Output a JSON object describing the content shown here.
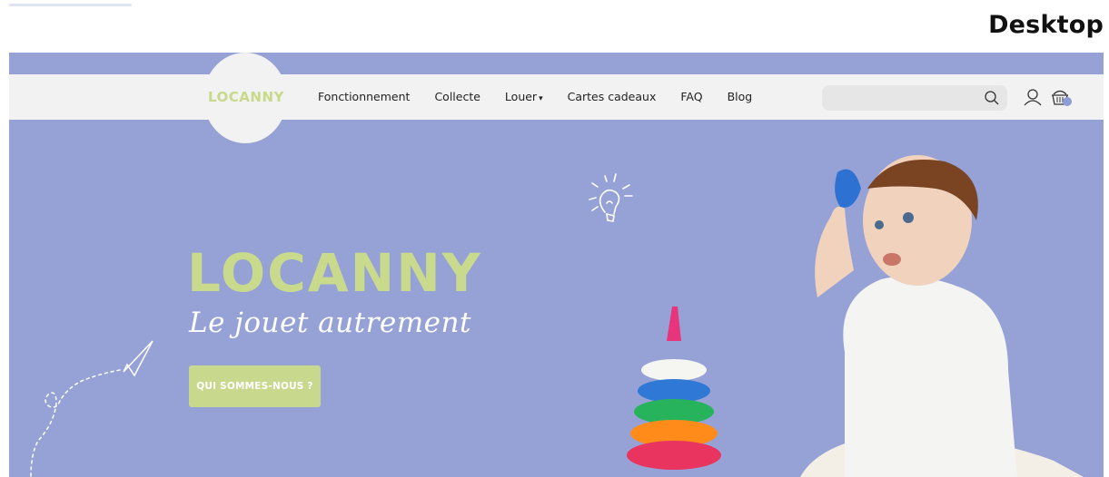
{
  "frame_label": "Desktop",
  "header": {
    "logo": "LOCANNY",
    "nav": [
      {
        "label": "Fonctionnement"
      },
      {
        "label": "Collecte"
      },
      {
        "label": "Louer",
        "caret": "▾"
      },
      {
        "label": "Cartes cadeaux"
      },
      {
        "label": "FAQ"
      },
      {
        "label": "Blog"
      }
    ],
    "search": {
      "value": "",
      "placeholder": ""
    },
    "icons": [
      "search-icon",
      "user-icon",
      "basket-icon"
    ]
  },
  "hero": {
    "brand": "LOCANNY",
    "tagline": "Le jouet autrement",
    "cta": "QUI SOMMES-NOUS ?",
    "decorations": [
      "lightbulb-doodle",
      "paper-plane-doodle"
    ],
    "image": "baby-with-stacking-rings-photo"
  },
  "colors": {
    "background": "#96a2d6",
    "nav_background": "#f1f2f1",
    "brand_green": "#c9da8c",
    "text_white": "#ffffff"
  }
}
